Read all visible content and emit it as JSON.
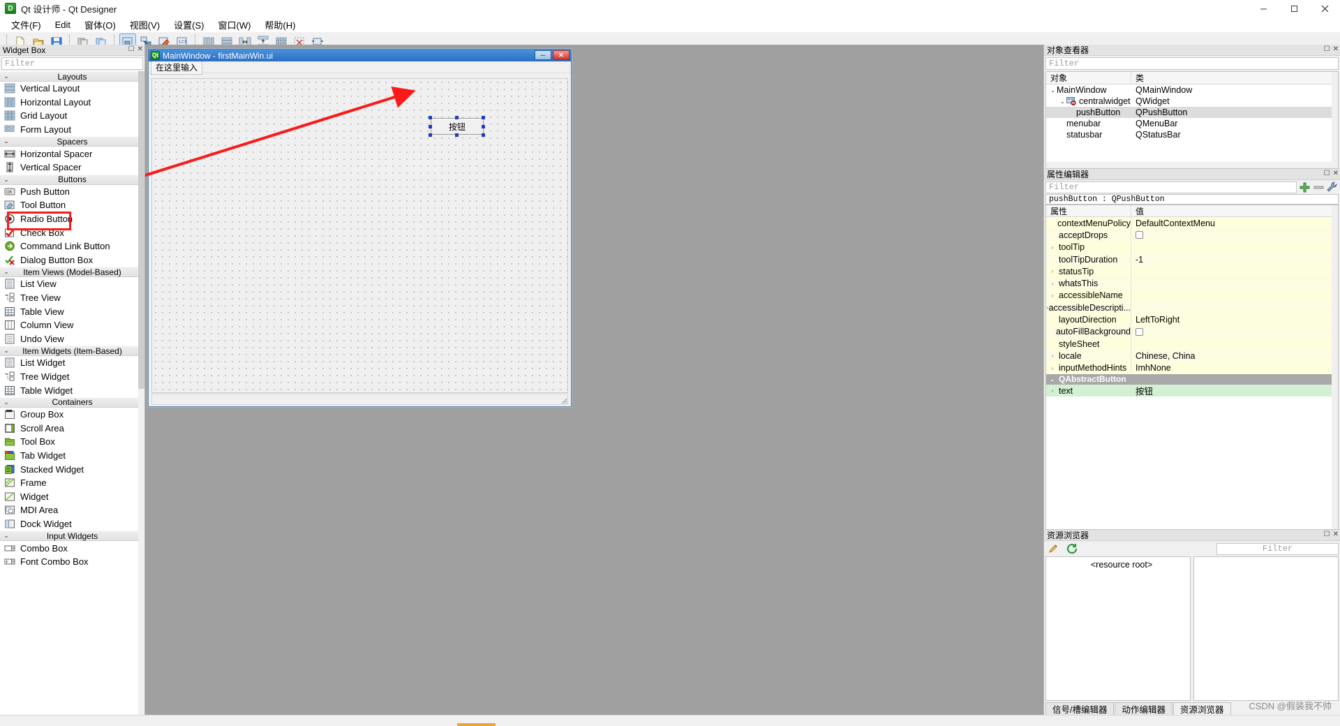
{
  "window": {
    "title": "Qt 设计师 - Qt Designer",
    "icon": "qt-designer-icon",
    "minimize": "minimize-icon",
    "maximize": "maximize-icon",
    "close": "close-icon"
  },
  "menubar": [
    {
      "label": "文件(F)"
    },
    {
      "label": "Edit"
    },
    {
      "label": "窗体(O)"
    },
    {
      "label": "视图(V)"
    },
    {
      "label": "设置(S)"
    },
    {
      "label": "窗口(W)"
    },
    {
      "label": "帮助(H)"
    }
  ],
  "toolbar": {
    "groups": [
      [
        "new-file-icon",
        "open-file-icon",
        "save-file-icon"
      ],
      [
        "undo-icon",
        "redo-icon"
      ],
      [
        "edit-widgets-icon",
        "edit-signals-slots-icon",
        "edit-buddies-icon",
        "edit-tab-order-icon"
      ],
      [
        "layout-vertical-icon",
        "layout-horizontal-icon",
        "layout-splitter-h-icon",
        "layout-splitter-v-icon",
        "layout-grid-icon",
        "layout-form-icon",
        "break-layout-icon",
        "adjust-size-icon"
      ]
    ]
  },
  "widget_box": {
    "title": "Widget Box",
    "filter_placeholder": "Filter",
    "float_btn": "float-icon",
    "close_btn": "close-icon",
    "groups": [
      {
        "name": "Layouts",
        "items": [
          {
            "label": "Vertical Layout",
            "icon": "vertical-layout-icon"
          },
          {
            "label": "Horizontal Layout",
            "icon": "horizontal-layout-icon"
          },
          {
            "label": "Grid Layout",
            "icon": "grid-layout-icon"
          },
          {
            "label": "Form Layout",
            "icon": "form-layout-icon"
          }
        ]
      },
      {
        "name": "Spacers",
        "items": [
          {
            "label": "Horizontal Spacer",
            "icon": "horizontal-spacer-icon"
          },
          {
            "label": "Vertical Spacer",
            "icon": "vertical-spacer-icon"
          }
        ]
      },
      {
        "name": "Buttons",
        "items": [
          {
            "label": "Push Button",
            "icon": "push-button-icon",
            "highlighted": true
          },
          {
            "label": "Tool Button",
            "icon": "tool-button-icon"
          },
          {
            "label": "Radio Button",
            "icon": "radio-button-icon"
          },
          {
            "label": "Check Box",
            "icon": "check-box-icon"
          },
          {
            "label": "Command Link Button",
            "icon": "command-link-button-icon"
          },
          {
            "label": "Dialog Button Box",
            "icon": "dialog-button-box-icon"
          }
        ]
      },
      {
        "name": "Item Views (Model-Based)",
        "items": [
          {
            "label": "List View",
            "icon": "list-view-icon"
          },
          {
            "label": "Tree View",
            "icon": "tree-view-icon"
          },
          {
            "label": "Table View",
            "icon": "table-view-icon"
          },
          {
            "label": "Column View",
            "icon": "column-view-icon"
          },
          {
            "label": "Undo View",
            "icon": "undo-view-icon"
          }
        ]
      },
      {
        "name": "Item Widgets (Item-Based)",
        "items": [
          {
            "label": "List Widget",
            "icon": "list-widget-icon"
          },
          {
            "label": "Tree Widget",
            "icon": "tree-widget-icon"
          },
          {
            "label": "Table Widget",
            "icon": "table-widget-icon"
          }
        ]
      },
      {
        "name": "Containers",
        "items": [
          {
            "label": "Group Box",
            "icon": "group-box-icon"
          },
          {
            "label": "Scroll Area",
            "icon": "scroll-area-icon"
          },
          {
            "label": "Tool Box",
            "icon": "tool-box-icon"
          },
          {
            "label": "Tab Widget",
            "icon": "tab-widget-icon"
          },
          {
            "label": "Stacked Widget",
            "icon": "stacked-widget-icon"
          },
          {
            "label": "Frame",
            "icon": "frame-icon"
          },
          {
            "label": "Widget",
            "icon": "widget-icon"
          },
          {
            "label": "MDI Area",
            "icon": "mdi-area-icon"
          },
          {
            "label": "Dock Widget",
            "icon": "dock-widget-icon"
          }
        ]
      },
      {
        "name": "Input Widgets",
        "items": [
          {
            "label": "Combo Box",
            "icon": "combo-box-icon"
          },
          {
            "label": "Font Combo Box",
            "icon": "font-combo-box-icon"
          }
        ]
      }
    ]
  },
  "form": {
    "title": "MainWindow - firstMainWin.ui",
    "icon": "qt-form-icon",
    "menu_placeholder": "在这里输入",
    "minimize_btn": "minimize-icon",
    "close_btn": "close-icon",
    "button": {
      "text": "按钮",
      "selected": true
    }
  },
  "object_inspector": {
    "title": "对象查看器",
    "filter_placeholder": "Filter",
    "float_btn": "float-icon",
    "close_btn": "close-icon",
    "headers": [
      "对象",
      "类"
    ],
    "rows": [
      {
        "name": "MainWindow",
        "class": "QMainWindow",
        "indent": 0,
        "expandable": true,
        "icon": null
      },
      {
        "name": "centralwidget",
        "class": "QWidget",
        "indent": 1,
        "expandable": true,
        "icon": "central-widget-icon"
      },
      {
        "name": "pushButton",
        "class": "QPushButton",
        "indent": 2,
        "expandable": false,
        "selected": true,
        "icon": null
      },
      {
        "name": "menubar",
        "class": "QMenuBar",
        "indent": 1,
        "expandable": false,
        "icon": null
      },
      {
        "name": "statusbar",
        "class": "QStatusBar",
        "indent": 1,
        "expandable": false,
        "icon": null
      }
    ]
  },
  "property_editor": {
    "title": "属性编辑器",
    "filter_placeholder": "Filter",
    "float_btn": "float-icon",
    "close_btn": "close-icon",
    "add_btn": "plus-icon",
    "remove_btn": "minus-icon",
    "config_btn": "wrench-icon",
    "object_line": "pushButton : QPushButton",
    "headers": [
      "属性",
      "值"
    ],
    "rows": [
      {
        "name": "contextMenuPolicy",
        "value": "DefaultContextMenu",
        "expandable": false,
        "type": "text"
      },
      {
        "name": "acceptDrops",
        "value": "",
        "expandable": false,
        "type": "checkbox"
      },
      {
        "name": "toolTip",
        "value": "",
        "expandable": true,
        "type": "text"
      },
      {
        "name": "toolTipDuration",
        "value": "-1",
        "expandable": false,
        "type": "text"
      },
      {
        "name": "statusTip",
        "value": "",
        "expandable": true,
        "type": "text"
      },
      {
        "name": "whatsThis",
        "value": "",
        "expandable": true,
        "type": "text"
      },
      {
        "name": "accessibleName",
        "value": "",
        "expandable": true,
        "type": "text"
      },
      {
        "name": "accessibleDescripti...",
        "value": "",
        "expandable": true,
        "type": "text"
      },
      {
        "name": "layoutDirection",
        "value": "LeftToRight",
        "expandable": false,
        "type": "text"
      },
      {
        "name": "autoFillBackground",
        "value": "",
        "expandable": false,
        "type": "checkbox"
      },
      {
        "name": "styleSheet",
        "value": "",
        "expandable": false,
        "type": "text"
      },
      {
        "name": "locale",
        "value": "Chinese, China",
        "expandable": true,
        "type": "text"
      },
      {
        "name": "inputMethodHints",
        "value": "ImhNone",
        "expandable": true,
        "type": "text"
      }
    ],
    "group_row": {
      "name": "QAbstractButton",
      "expandable": true
    },
    "after_group_rows": [
      {
        "name": "text",
        "value": "按钮",
        "expandable": true,
        "type": "text"
      }
    ]
  },
  "resource_browser": {
    "title": "资源浏览器",
    "float_btn": "float-icon",
    "close_btn": "close-icon",
    "edit_btn": "pencil-icon",
    "reload_btn": "reload-icon",
    "filter_placeholder": "Filter",
    "root_label": "<resource root>"
  },
  "bottom_tabs": [
    {
      "label": "信号/槽编辑器",
      "active": false
    },
    {
      "label": "动作编辑器",
      "active": false
    },
    {
      "label": "资源浏览器",
      "active": true
    }
  ],
  "watermark": "CSDN @假装我不帅",
  "colors": {
    "accent_blue": "#2a6fc4",
    "highlight_red": "#fb1a1a",
    "property_yellow": "#fefedd",
    "group_gray": "#a8a8a8",
    "canvas_gray": "#a0a0a0"
  }
}
